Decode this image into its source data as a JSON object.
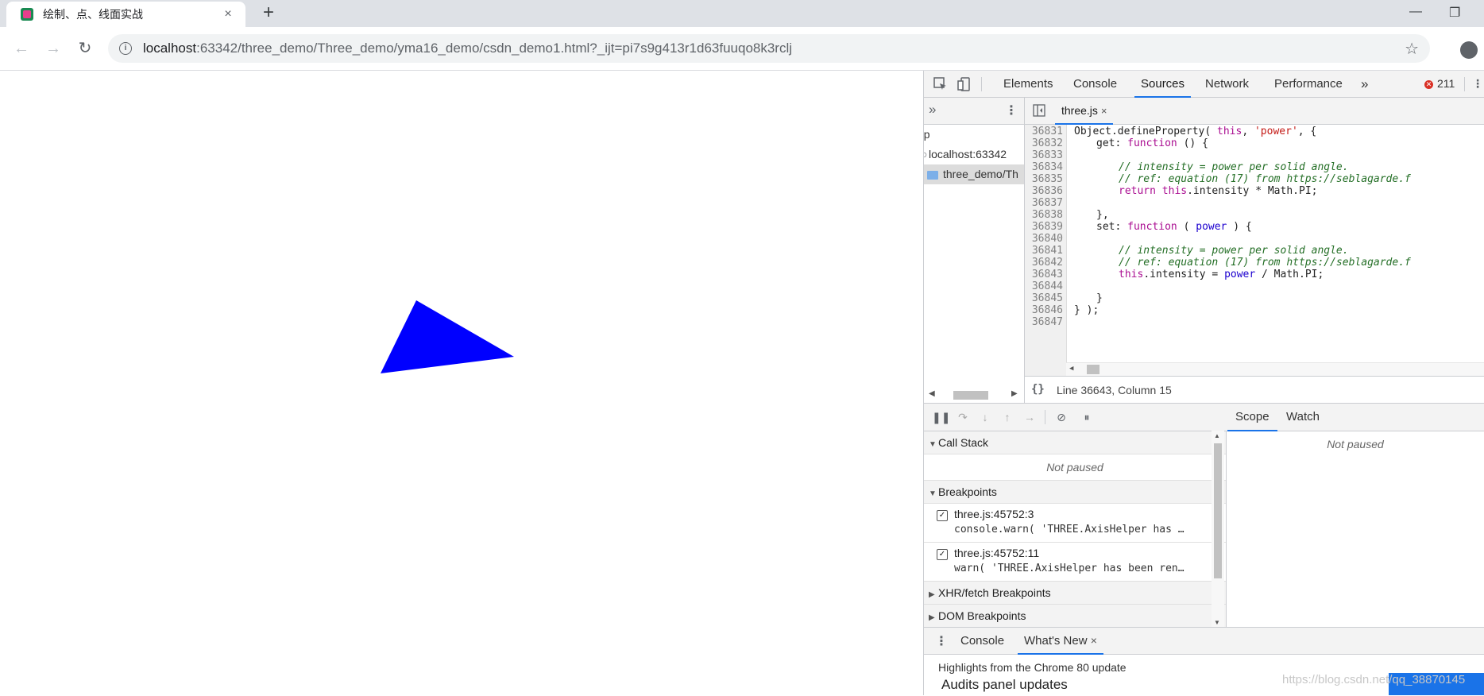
{
  "browser": {
    "tab_title": "绘制、点、线面实战",
    "tab_close": "×",
    "new_tab": "+",
    "url_host": "localhost",
    "url_rest": ":63342/three_demo/Three_demo/yma16_demo/csdn_demo1.html?_ijt=pi7s9g413r1d63fuuqo8k3rclj",
    "info_glyph": "i"
  },
  "scene": {
    "shape": "triangle",
    "color": "#0000ff"
  },
  "devtools": {
    "tabs": [
      "Elements",
      "Console",
      "Sources",
      "Network",
      "Performance"
    ],
    "active_tab": "Sources",
    "more_tabs": "»",
    "error_count": "211",
    "navigator": {
      "top": "op",
      "host": "localhost:63342",
      "folder": "three_demo/Th"
    },
    "editor": {
      "file_tab": "three.js",
      "file_tab_close": "×",
      "lines": [
        {
          "n": "36831",
          "code": "Object.defineProperty( this, 'power', {"
        },
        {
          "n": "36832",
          "code": "get: function () {"
        },
        {
          "n": "36833",
          "code": ""
        },
        {
          "n": "36834",
          "code": "// intensity = power per solid angle."
        },
        {
          "n": "36835",
          "code": "// ref: equation (17) from https://seblagarde.f"
        },
        {
          "n": "36836",
          "code": "return this.intensity * Math.PI;"
        },
        {
          "n": "36837",
          "code": ""
        },
        {
          "n": "36838",
          "code": "},"
        },
        {
          "n": "36839",
          "code": "set: function ( power ) {"
        },
        {
          "n": "36840",
          "code": ""
        },
        {
          "n": "36841",
          "code": "// intensity = power per solid angle."
        },
        {
          "n": "36842",
          "code": "// ref: equation (17) from https://seblagarde.f"
        },
        {
          "n": "36843",
          "code": "this.intensity = power / Math.PI;"
        },
        {
          "n": "36844",
          "code": ""
        },
        {
          "n": "36845",
          "code": "}"
        },
        {
          "n": "36846",
          "code": "} );"
        },
        {
          "n": "36847",
          "code": ""
        }
      ],
      "status_braces": "{}",
      "status_position": "Line 36643, Column 15"
    },
    "debugger": {
      "call_stack_label": "Call Stack",
      "call_stack_empty": "Not paused",
      "breakpoints_label": "Breakpoints",
      "breakpoints": [
        {
          "location": "three.js:45752:3",
          "code": "console.warn( 'THREE.AxisHelper has …"
        },
        {
          "location": "three.js:45752:11",
          "code": "warn( 'THREE.AxisHelper has been ren…"
        }
      ],
      "xhr_label": "XHR/fetch Breakpoints",
      "dom_label": "DOM Breakpoints"
    },
    "scope": {
      "tabs": [
        "Scope",
        "Watch"
      ],
      "empty": "Not paused"
    },
    "drawer": {
      "tabs": [
        "Console",
        "What's New"
      ],
      "close": "×",
      "highlights": "Highlights from the Chrome 80 update",
      "audits": "Audits panel updates"
    }
  },
  "watermark": "https://blog.csdn.net/qq_38870145"
}
